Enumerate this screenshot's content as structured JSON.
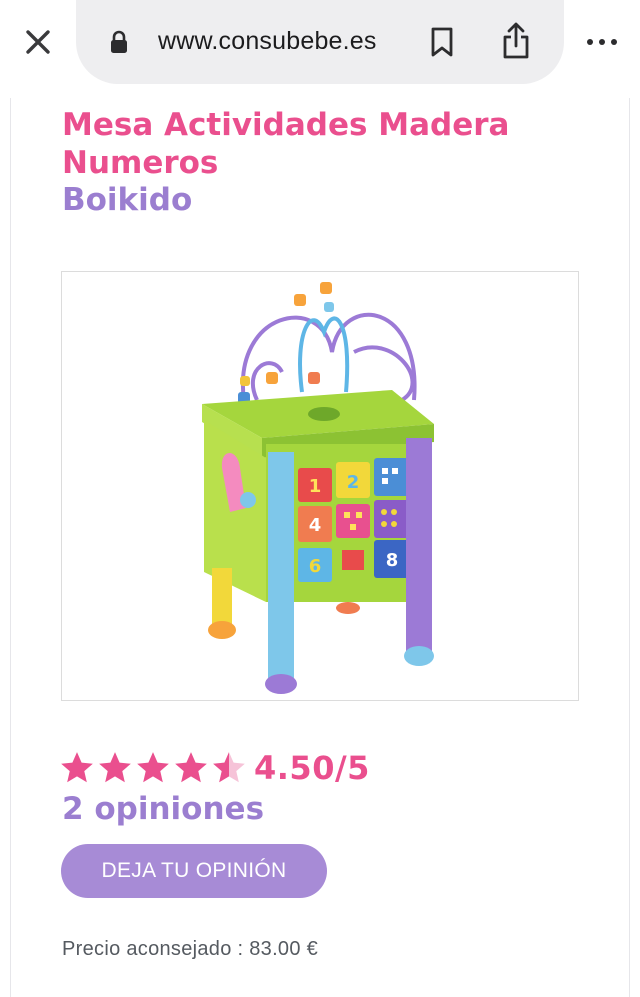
{
  "browser": {
    "url": "www.consubebe.es",
    "icons": [
      "close-icon",
      "lock-icon",
      "bookmark-icon",
      "share-icon",
      "more-icon"
    ]
  },
  "product": {
    "title": "Mesa Actividades Madera Numeros",
    "brand": "Boikido",
    "image_alt": "Mesa de actividades de madera con números",
    "rating": {
      "value": 4.5,
      "max": 5,
      "display": "4.50/5",
      "stars_full": 4,
      "stars_half": 1
    },
    "reviews_label": "2 opiniones",
    "review_button_label": "DEJA TU OPINIÓN",
    "price_label": "Precio aconsejado : 83.00 €"
  },
  "colors": {
    "title_pink": "#ea4f8e",
    "brand_purple": "#9b7ed0",
    "button_purple": "#a78bd6",
    "star_pink": "#ea4f8e",
    "star_empty": "#f6c3d8"
  }
}
